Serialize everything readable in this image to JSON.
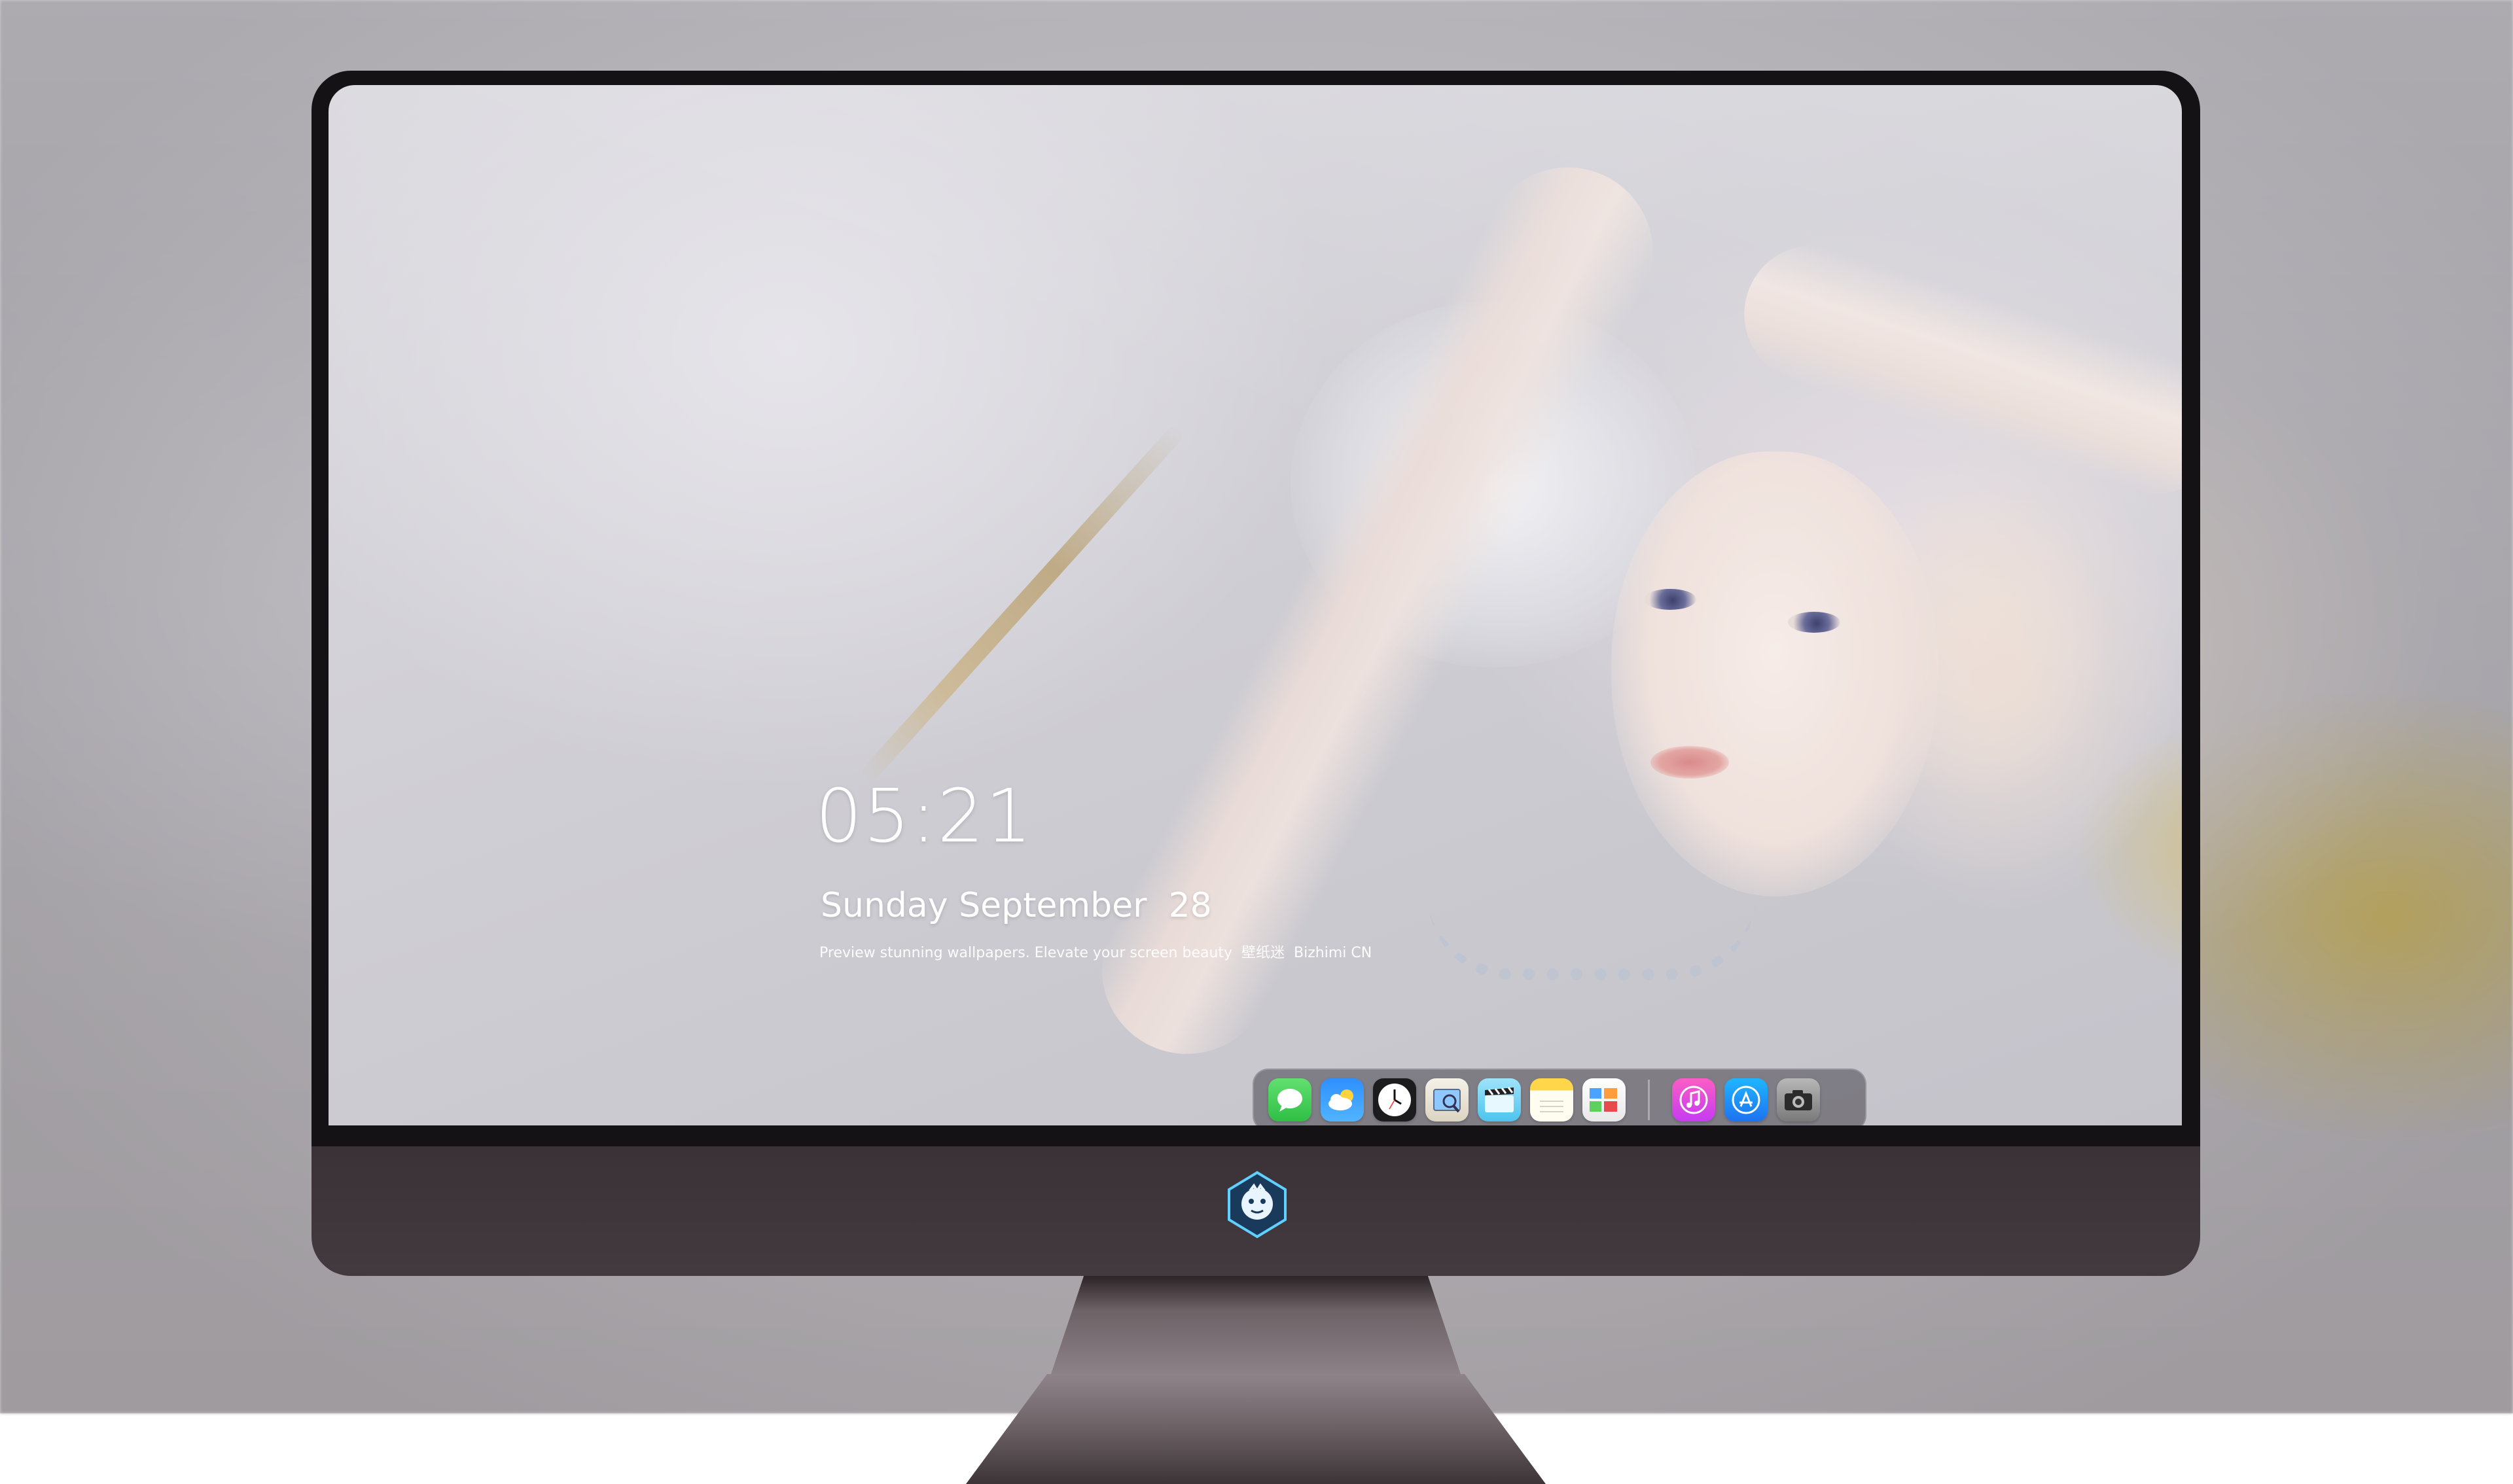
{
  "lock_screen": {
    "time": "05:21",
    "date": "Sunday September  28",
    "tagline": "Preview stunning wallpapers. Elevate your screen beauty  壁纸迷  Bizhimi CN"
  },
  "dock": {
    "apps": [
      {
        "name": "Messages",
        "icon": "messages-icon"
      },
      {
        "name": "Weather",
        "icon": "weather-icon"
      },
      {
        "name": "Clock",
        "icon": "clock-icon"
      },
      {
        "name": "Preview",
        "icon": "preview-icon"
      },
      {
        "name": "Clips",
        "icon": "clapperboard-icon"
      },
      {
        "name": "Notes",
        "icon": "notes-icon"
      },
      {
        "name": "Photos",
        "icon": "photos-icon"
      },
      {
        "name": "Music",
        "icon": "music-note-icon"
      },
      {
        "name": "App Store",
        "icon": "app-store-icon"
      },
      {
        "name": "Camera",
        "icon": "camera-icon"
      }
    ]
  },
  "desktop": {
    "shortcut_icon": "crystal-icon",
    "monitor_logo": "mascot-logo"
  },
  "colors": {
    "dock_bg": "#46424a",
    "bezel": "#141214",
    "chin": "#3a3236",
    "text": "#ffffff"
  }
}
